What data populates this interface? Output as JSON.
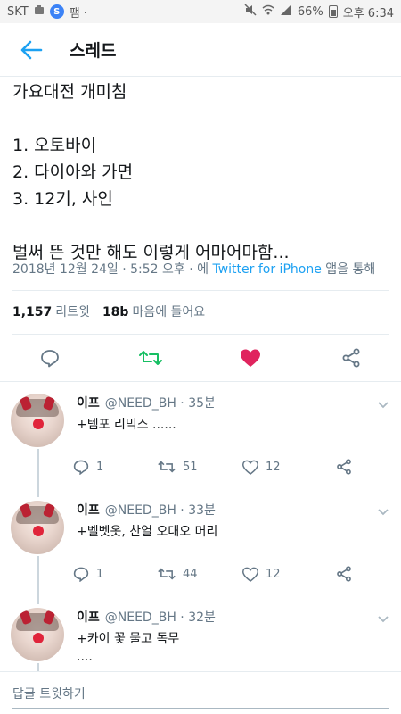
{
  "status_bar": {
    "carrier": "SKT",
    "extra": "팸 ·",
    "battery": "66%",
    "time_label": "오후 6:34"
  },
  "header": {
    "title": "스레드"
  },
  "tweet": {
    "lines": [
      "가요대전 개미침",
      "",
      "1. 오토바이",
      "2. 다이아와 가면",
      "3. 12기, 사인",
      "",
      "벌써 뜬 것만 해도 이렇게 어마어마함..."
    ],
    "date": "2018년 12월 24일 · 5:52 오후 · 에",
    "source": "Twitter for iPhone",
    "source_suffix": "앱을 통해",
    "retweet_count": "1,157",
    "retweet_label": "리트윗",
    "like_count": "18b",
    "like_label": "마음에 들어요"
  },
  "replies": [
    {
      "name": "이프",
      "handle": "@NEED_BH",
      "time": "· 35분",
      "text": "+템포 리믹스 ......",
      "text2": "",
      "reply_count": "1",
      "retweet_count": "51",
      "like_count": "12"
    },
    {
      "name": "이프",
      "handle": "@NEED_BH",
      "time": "· 33분",
      "text": "+벨벳옷, 찬열 오대오 머리",
      "text2": "",
      "reply_count": "1",
      "retweet_count": "44",
      "like_count": "12"
    },
    {
      "name": "이프",
      "handle": "@NEED_BH",
      "time": "· 32분",
      "text": "+카이 꽃 물고 독무",
      "text2": "....",
      "reply_count": "",
      "retweet_count": "",
      "like_count": ""
    }
  ],
  "reply_bar": {
    "placeholder": "답글 트윗하기"
  },
  "colors": {
    "accent": "#1da1f2",
    "retweet_active": "#17bf63",
    "like_active": "#e0245e"
  }
}
